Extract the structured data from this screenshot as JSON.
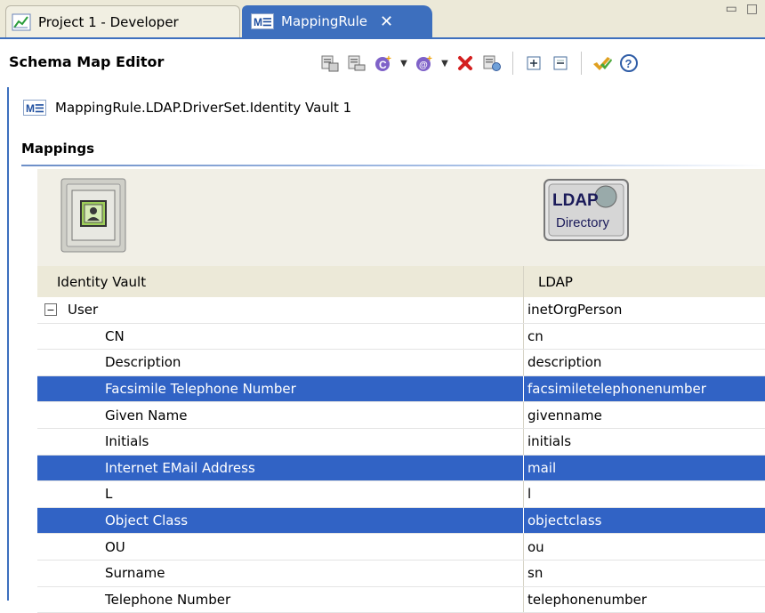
{
  "tabs": [
    {
      "label": "Project 1 - Developer",
      "icon": "developer-perspective-icon"
    },
    {
      "label": "MappingRule",
      "icon": "mapping-rule-icon",
      "active": true
    }
  ],
  "icon_text": {
    "mapping_rule": "M☰"
  },
  "window_controls": {
    "minimize": "▭",
    "maximize": "□"
  },
  "header": {
    "title": "Schema Map Editor",
    "toolbar": [
      "add-class-mapping-icon",
      "add-attribute-mapping-icon",
      "add-class-dropdown",
      "add-attribute-dropdown",
      "delete-icon",
      "refresh-schema-icon",
      "expand-all-icon",
      "collapse-all-icon",
      "check-icon",
      "help-icon"
    ]
  },
  "rule_path": "MappingRule.LDAP.DriverSet.Identity Vault 1",
  "section_title": "Mappings",
  "ldap_logo": {
    "line1": "LDAP",
    "line2": "Directory"
  },
  "table": {
    "headers": [
      "Identity Vault",
      "LDAP"
    ],
    "rows": [
      {
        "vault": "User",
        "ldap": "inetOrgPerson",
        "level": 0,
        "expanded": true,
        "selected": false
      },
      {
        "vault": "CN",
        "ldap": "cn",
        "level": 1,
        "selected": false
      },
      {
        "vault": "Description",
        "ldap": "description",
        "level": 1,
        "selected": false
      },
      {
        "vault": "Facsimile Telephone Number",
        "ldap": "facsimiletelephonenumber",
        "level": 1,
        "selected": true
      },
      {
        "vault": "Given Name",
        "ldap": "givenname",
        "level": 1,
        "selected": false
      },
      {
        "vault": "Initials",
        "ldap": "initials",
        "level": 1,
        "selected": false
      },
      {
        "vault": "Internet EMail Address",
        "ldap": "mail",
        "level": 1,
        "selected": true
      },
      {
        "vault": "L",
        "ldap": "l",
        "level": 1,
        "selected": false
      },
      {
        "vault": "Object Class",
        "ldap": "objectclass",
        "level": 1,
        "selected": true
      },
      {
        "vault": "OU",
        "ldap": "ou",
        "level": 1,
        "selected": false
      },
      {
        "vault": "Surname",
        "ldap": "sn",
        "level": 1,
        "selected": false
      },
      {
        "vault": "Telephone Number",
        "ldap": "telephonenumber",
        "level": 1,
        "selected": false
      }
    ]
  },
  "colors": {
    "accent": "#3d6fbe",
    "selection": "#3163c5",
    "delete": "#d42020"
  }
}
